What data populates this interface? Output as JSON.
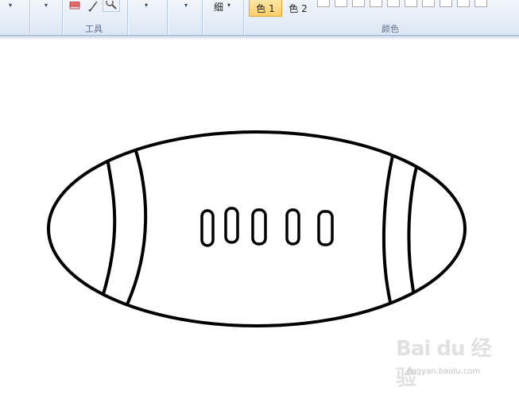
{
  "ribbon": {
    "tools_group_label": "工具",
    "colors_group_label": "颜色",
    "thickness_label": "细",
    "color1_label": "色 1",
    "color2_label": "色 2",
    "dropdown_glyph": "▾"
  },
  "colors": {
    "accent": "#ffcf66",
    "ribbon_bg": "#dce6f4",
    "stroke": "#000000"
  },
  "watermark": {
    "brand": "Bai du 经验",
    "url": "jingyan.baidu.com"
  }
}
